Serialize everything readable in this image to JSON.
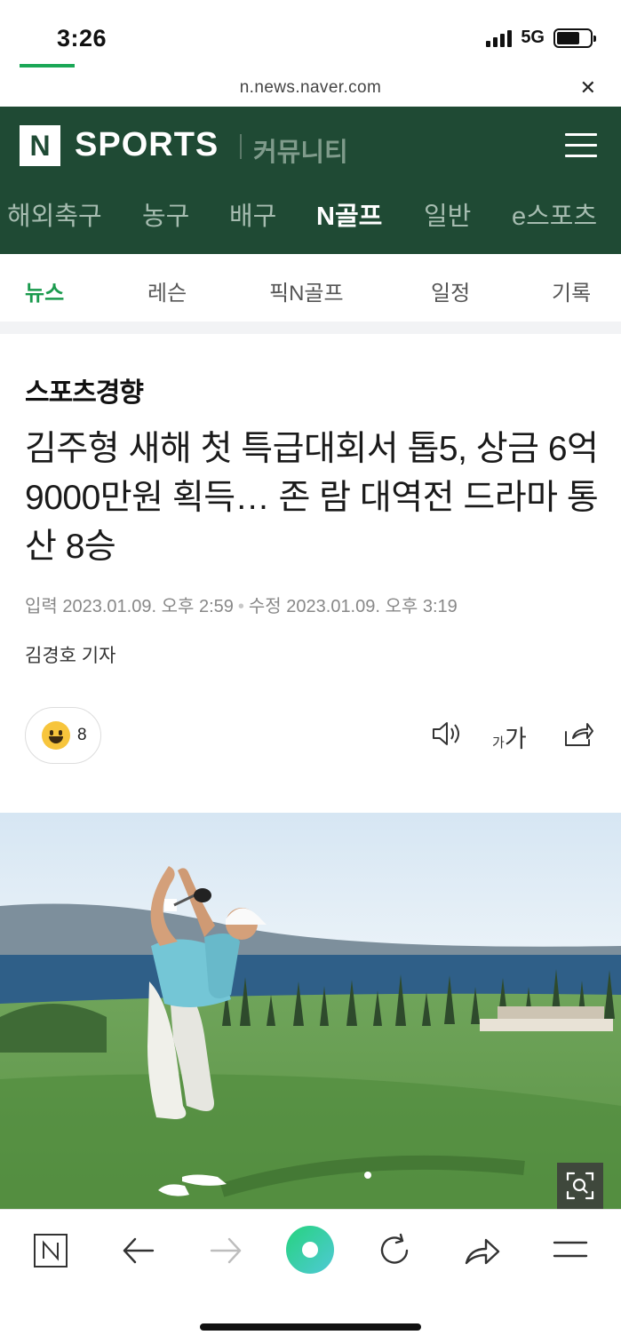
{
  "status_bar": {
    "time": "3:26",
    "network": "5G"
  },
  "url_bar": {
    "url": "n.news.naver.com",
    "close_icon": "close-icon"
  },
  "header": {
    "logo_letter": "N",
    "logo_text": "SPORTS",
    "community_label": "커뮤니티",
    "sport_tabs": [
      {
        "label": "해외축구"
      },
      {
        "label": "농구"
      },
      {
        "label": "배구"
      },
      {
        "label": "N골프"
      },
      {
        "label": "일반"
      },
      {
        "label": "e스포츠"
      }
    ],
    "active_sport_tab": "N골프",
    "brand_color": "#1f4a34"
  },
  "sub_tabs": [
    {
      "label": "뉴스"
    },
    {
      "label": "레슨"
    },
    {
      "label": "픽N골프"
    },
    {
      "label": "일정"
    },
    {
      "label": "기록"
    }
  ],
  "active_sub_tab": "뉴스",
  "accent_color": "#1aa756",
  "article": {
    "press": "스포츠경향",
    "headline": "김주형 새해 첫 특급대회서 톱5, 상금 6억 9000만원 획득… 존 람 대역전 드라마 통산 8승",
    "input_label": "입력",
    "input_date": "2023.01.09. 오후 2:59",
    "modified_label": "수정",
    "modified_date": "2023.01.09. 오후 3:19",
    "reporter": "김경호 기자",
    "reaction_count": "8",
    "font_small": "가",
    "font_big": "가"
  },
  "icons": {
    "speaker": "speaker-icon",
    "share": "share-icon",
    "zoom": "zoom-search-icon",
    "back": "back-arrow-icon",
    "forward": "forward-arrow-icon",
    "green_dot": "green-dot-icon",
    "reload": "reload-icon",
    "share_arrow": "share-arrow-icon",
    "menu": "menu-icon"
  }
}
